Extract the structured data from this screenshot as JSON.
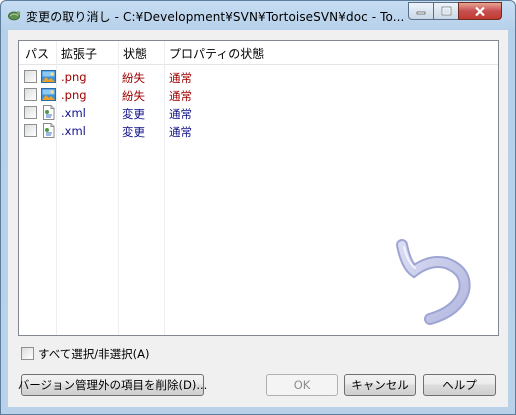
{
  "window": {
    "title": "変更の取り消し - C:¥Development¥SVN¥TortoiseSVN¥doc - To...",
    "icon": "tortoise-icon"
  },
  "list": {
    "columns": [
      "パス",
      "拡張子",
      "状態",
      "プロパティの状態"
    ],
    "rows": [
      {
        "checked": false,
        "icon": "image-file-icon",
        "ext": ".png",
        "status": "紛失",
        "prop_status": "通常",
        "status_kind": "missing"
      },
      {
        "checked": false,
        "icon": "image-file-icon",
        "ext": ".png",
        "status": "紛失",
        "prop_status": "通常",
        "status_kind": "missing"
      },
      {
        "checked": false,
        "icon": "xml-file-icon",
        "ext": ".xml",
        "status": "変更",
        "prop_status": "通常",
        "status_kind": "modified"
      },
      {
        "checked": false,
        "icon": "xml-file-icon",
        "ext": ".xml",
        "status": "変更",
        "prop_status": "通常",
        "status_kind": "modified"
      }
    ]
  },
  "select_all": {
    "label": "すべて選択/非選択(A)",
    "checked": false
  },
  "buttons": {
    "remove": "バージョン管理外の項目を削除(D)...",
    "ok": "OK",
    "cancel": "キャンセル",
    "help": "ヘルプ"
  },
  "colors": {
    "missing": "#a00000",
    "modified": "#101088",
    "title_bar": "#b9d2ea"
  }
}
